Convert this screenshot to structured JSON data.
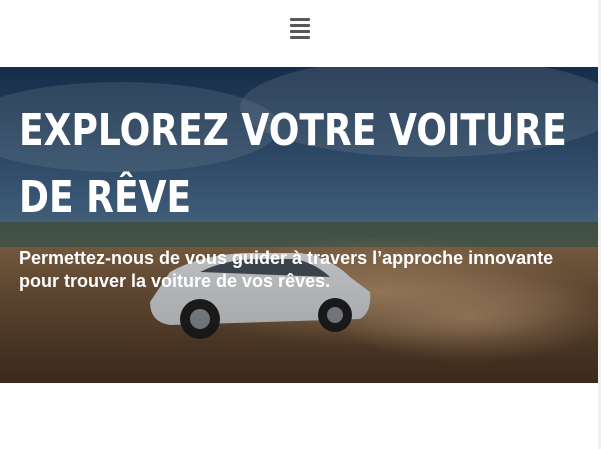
{
  "header": {
    "menu_icon": "hamburger-menu-icon"
  },
  "hero": {
    "title": "EXPLOREZ VOTRE VOITURE DE RÊVE",
    "subtitle": "Permettez-nous de vous guider à travers l’approche innovante pour trouver la voiture de vos rêves.",
    "background_image": "white-sedan-drifting-on-dirt-road"
  },
  "colors": {
    "header_bg": "#ffffff",
    "menu_icon": "#595959",
    "hero_text": "#ffffff",
    "sky": "#3b5f86"
  }
}
